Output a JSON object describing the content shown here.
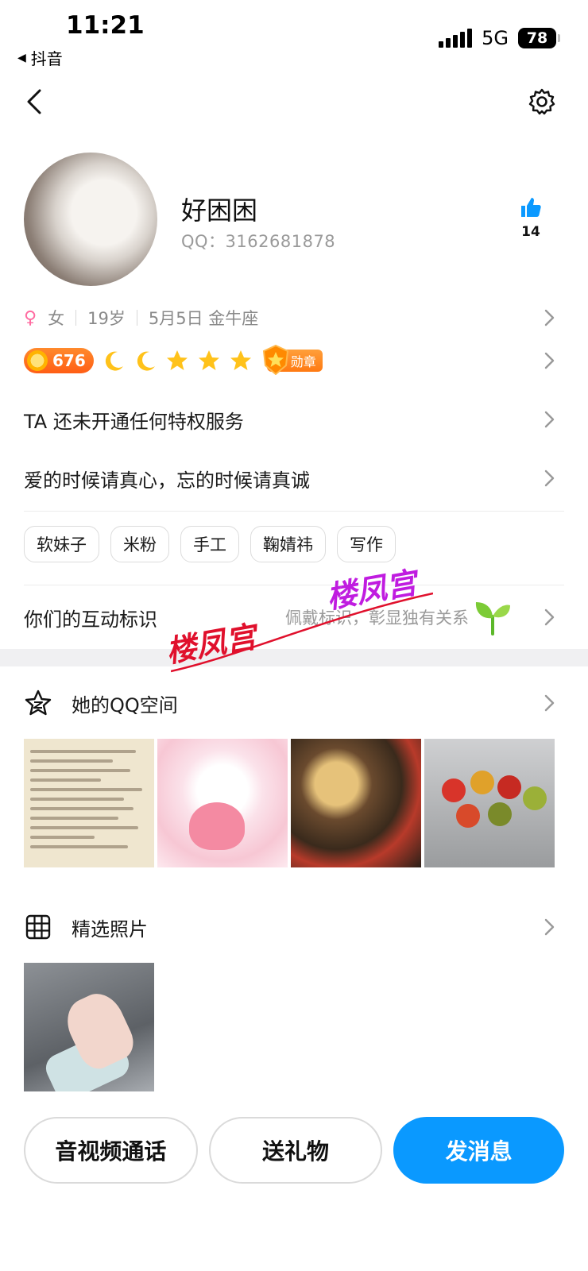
{
  "status_bar": {
    "time": "11:21",
    "back_app": "抖音",
    "network": "5G",
    "battery": "78"
  },
  "profile": {
    "nickname": "好困困",
    "qq": "QQ：3162681878",
    "like_count": "14",
    "gender": "女",
    "age": "19岁",
    "birthday": "5月5日 金牛座"
  },
  "badges": {
    "level": "676",
    "medal_label": "勋章"
  },
  "privilege_text": "TA 还未开通任何特权服务",
  "signature": "爱的时候请真心，忘的时候请真诚",
  "tags": [
    "软妹子",
    "米粉",
    "手工",
    "鞠婧祎",
    "写作"
  ],
  "interaction": {
    "title": "你们的互动标识",
    "hint": "佩戴标识，彰显独有关系"
  },
  "qzone": {
    "title": "她的QQ空间"
  },
  "photos": {
    "title": "精选照片"
  },
  "watermark": {
    "text1": "楼凤宫",
    "text2": "楼凤宫"
  },
  "actions": {
    "call": "音视频通话",
    "gift": "送礼物",
    "message": "发消息"
  },
  "colors": {
    "primary": "#0a99ff",
    "level_orange": "#ff6a1a",
    "female_pink": "#ff6aa0"
  }
}
